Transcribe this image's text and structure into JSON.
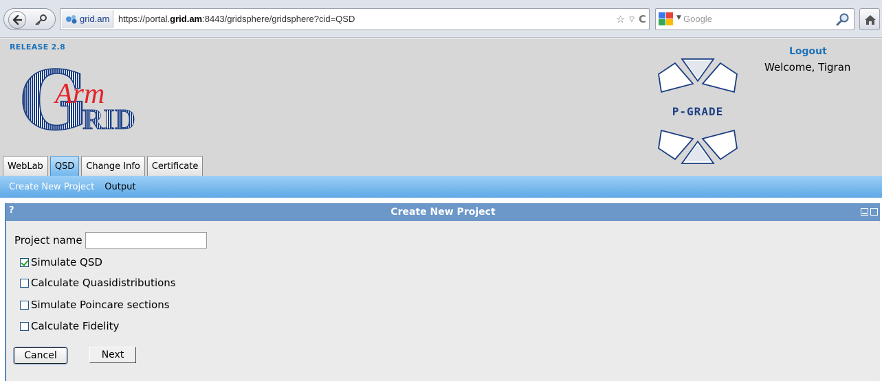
{
  "browser": {
    "site_chip": "grid.am",
    "url_prefix": "https://portal.",
    "url_host": "grid.am",
    "url_suffix": ":8443/gridsphere/gridsphere?cid=QSD",
    "search_placeholder": "Google"
  },
  "header": {
    "release": "RELEASE 2.8",
    "logout": "Logout",
    "welcome": "Welcome, Tigran",
    "logo_text_top": "Arm",
    "logo_text_bottom": "RID",
    "logo_letter": "G",
    "pgrade": "P-GRADE"
  },
  "tabs": [
    {
      "label": "WebLab",
      "active": false
    },
    {
      "label": "QSD",
      "active": true
    },
    {
      "label": "Change Info",
      "active": false
    },
    {
      "label": "Certificate",
      "active": false
    }
  ],
  "subnav": {
    "create": "Create New Project",
    "output": "Output"
  },
  "portlet": {
    "help": "?",
    "title": "Create New Project",
    "project_name_label": "Project name",
    "project_name_value": "",
    "options": [
      {
        "label": "Simulate QSD",
        "checked": true
      },
      {
        "label": "Calculate Quasidistributions",
        "checked": false
      },
      {
        "label": "Simulate Poincare sections",
        "checked": false
      },
      {
        "label": "Calculate Fidelity",
        "checked": false
      }
    ],
    "cancel_label": "Cancel",
    "next_label": "Next"
  },
  "colors": {
    "accent_blue": "#1e73b8",
    "portlet_title_bg": "#6c97c9",
    "header_bg": "#d7d7d7",
    "logo_red": "#e2242a",
    "logo_blue": "#1c3f84"
  }
}
